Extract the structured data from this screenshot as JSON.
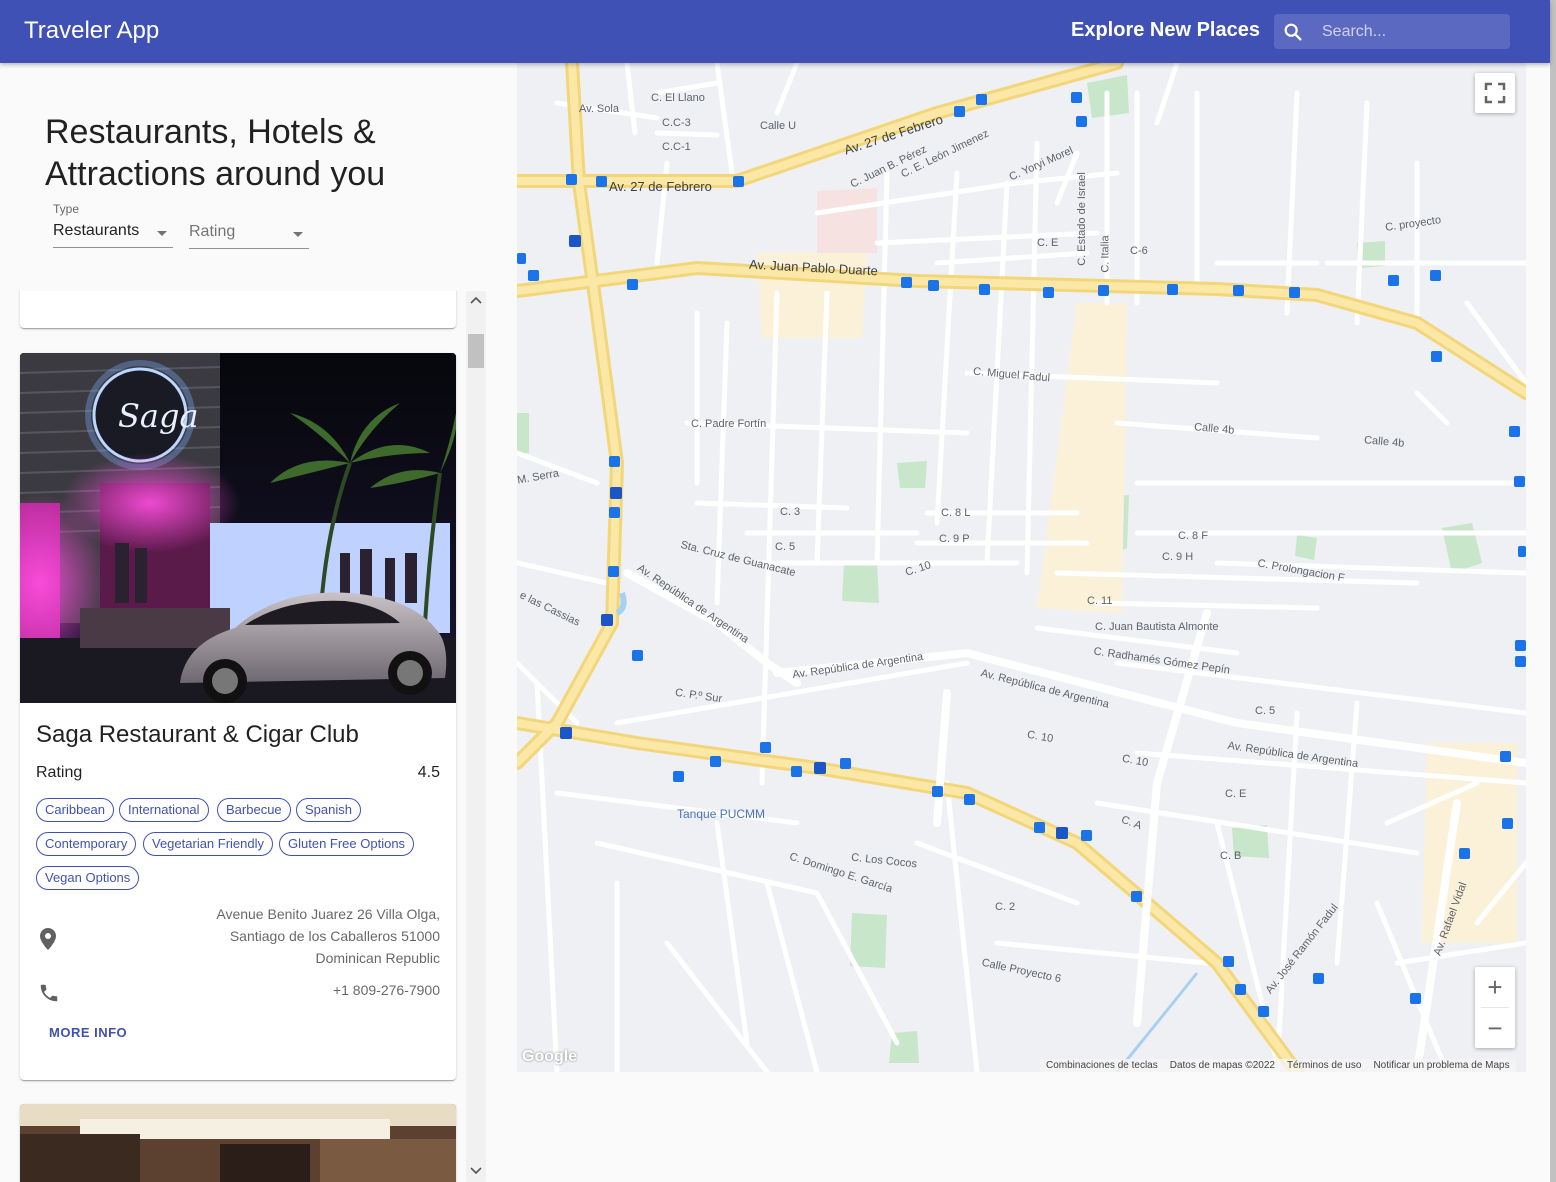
{
  "appbar": {
    "title": "Traveler App",
    "explore": "Explore New Places",
    "search_placeholder": "Search...",
    "color": "#3f51b5"
  },
  "panel": {
    "heading": "Restaurants, Hotels & Attractions around you",
    "type_label": "Type",
    "type_value": "Restaurants",
    "rating_placeholder": "Rating"
  },
  "place": {
    "name": "Saga Restaurant & Cigar Club",
    "rating_label": "Rating",
    "rating": "4.5",
    "cuisines": [
      "Caribbean",
      "International",
      "Barbecue",
      "Spanish",
      "Contemporary",
      "Vegetarian Friendly",
      "Gluten Free Options",
      "Vegan Options"
    ],
    "address_lines": [
      "Avenue Benito Juarez 26 Villa Olga,",
      "Santiago de los Caballeros 51000",
      "Dominican Republic"
    ],
    "phone": "+1 809-276-7900",
    "more_info": "MORE INFO",
    "sign": "Saga"
  },
  "map": {
    "labels": {
      "av27a": "Av. 27 de Febrero",
      "av27b": "Av. 27 de Febrero",
      "avjpd": "Av. Juan Pablo Duarte",
      "avra1": "Av. República de Argentina",
      "avra2": "Av. República de Argentina",
      "avra3": "Av. República de Argentina",
      "avra4": "Av. República de Argentina",
      "avsola": "Av. Sola",
      "elllano": "C. El Llano",
      "cc3": "C.C-3",
      "cc1": "C.C-1",
      "calleu": "Calle U",
      "jbperez": "C. Juan B. Pérez",
      "eleon": "C. E. León Jimenez",
      "yoryi": "C. Yoryi Morel",
      "ce": "C. E",
      "c6": "C-6",
      "estado": "C. Estado de Israel",
      "italia": "C. Italia",
      "mfadul": "C. Miguel Fadul",
      "pfortin": "C. Padre Fortín",
      "c3a": "C. 3",
      "c5a": "C. 5",
      "c8l": "C. 8 L",
      "c9p": "C. 9 P",
      "c10a": "C. 10",
      "c11": "C. 11",
      "jba": "C. Juan Bautista Almonte",
      "rgp": "C. Radhamés Gómez Pepín",
      "calle4b": "Calle 4b",
      "calle4b2": "Calle 4b",
      "c8f": "C. 8 F",
      "c9h": "C. 9 H",
      "prolf": "C. Prolongacion F",
      "cruz": "Sta. Cruz de Guanacate",
      "cpsur": "C. P.º Sur",
      "tanque": "Tanque PUCMM",
      "loscocos": "C. Los Cocos",
      "dgarcia": "C. Domingo E. García",
      "c2": "C. 2",
      "proy6": "Calle Proyecto 6",
      "cb": "C. B",
      "ca": "C. A",
      "cee": "C. E",
      "c10b": "C. 10",
      "c10c": "C. 10",
      "c5b": "C. 5",
      "serra": "M. Serra",
      "cassias": "e las Cassias",
      "proyecto": "C. proyecto",
      "jrfadul": "Av. José Ramón Fadul",
      "rvidal": "Av. Rafael Vidal"
    },
    "attribution": [
      "Combinaciones de teclas",
      "Datos de mapas ©2022",
      "Términos de uso",
      "Notificar un problema de Maps"
    ],
    "google": "Google",
    "zoom_in": "+",
    "zoom_out": "−"
  }
}
